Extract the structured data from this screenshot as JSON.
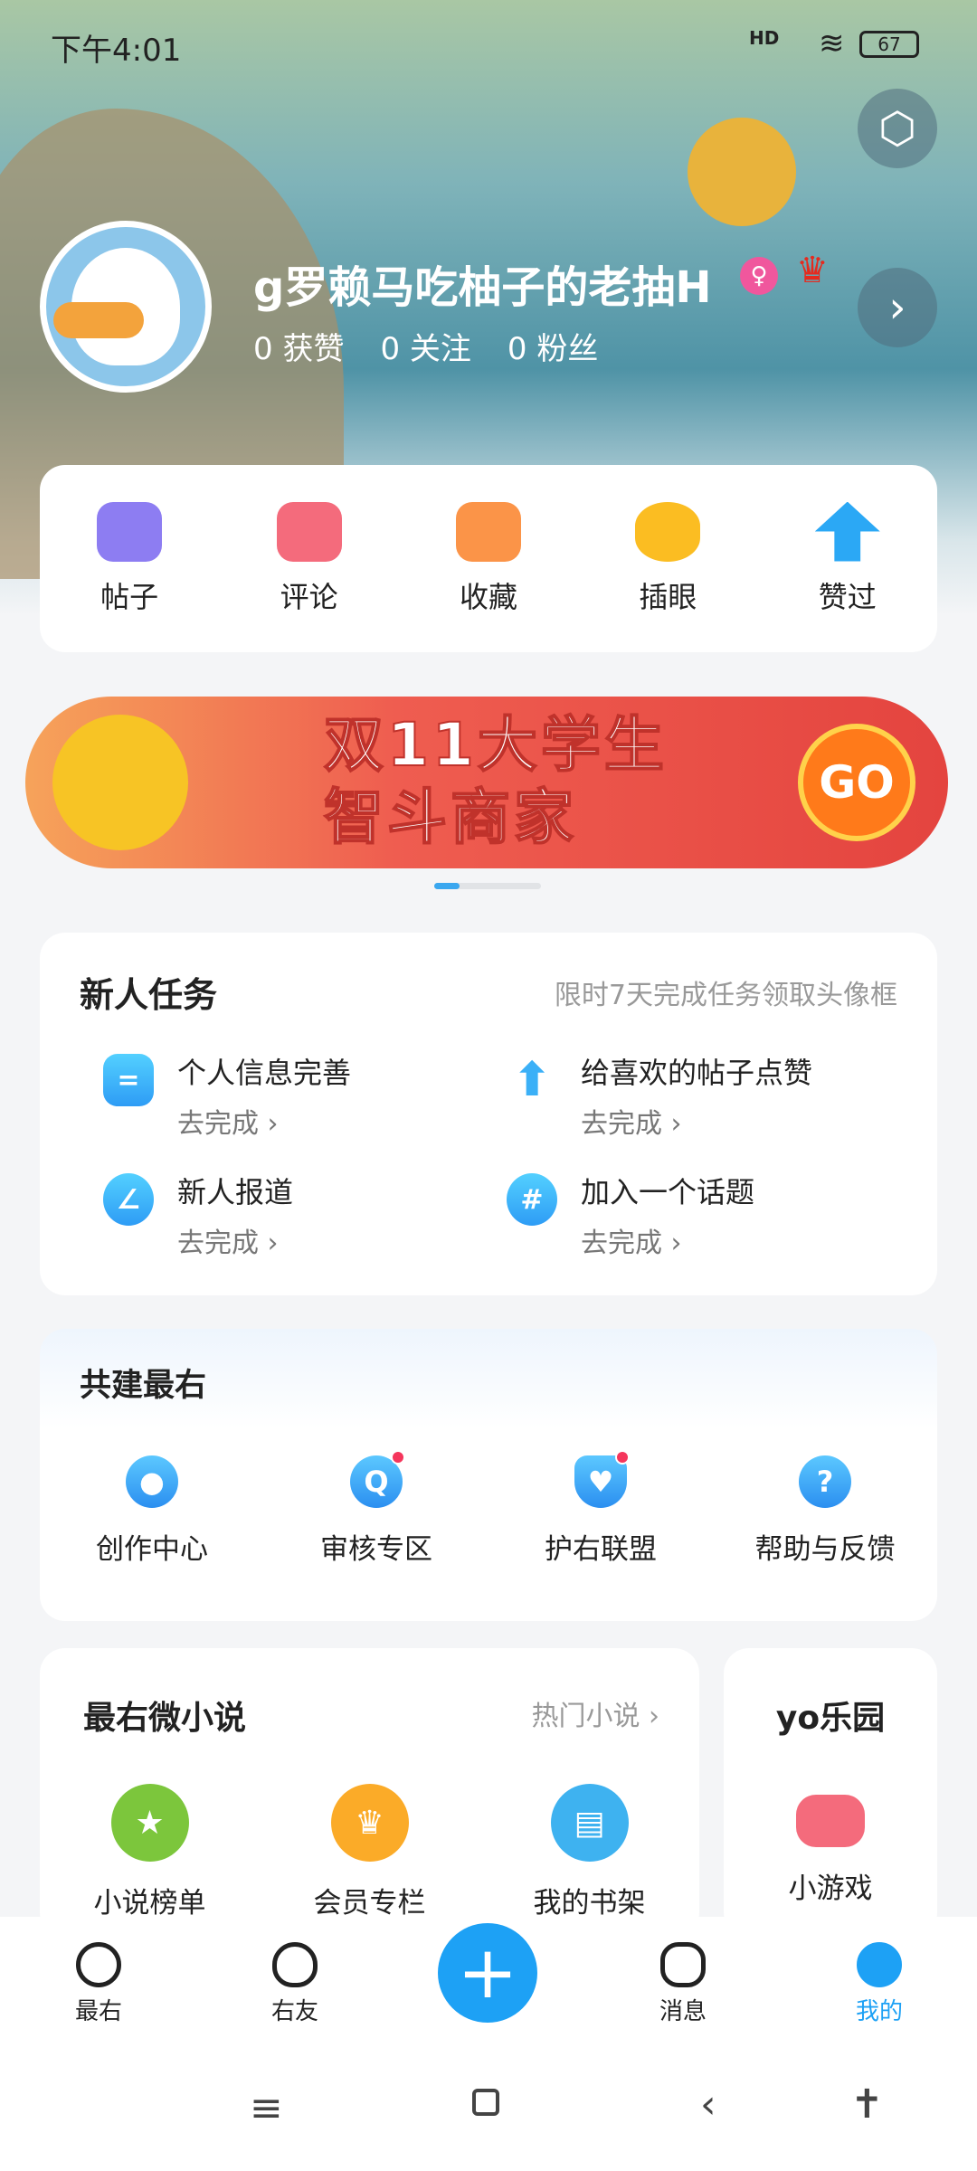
{
  "status_bar": {
    "time": "下午4:01",
    "network": "HD",
    "battery": "67"
  },
  "profile": {
    "username": "g罗赖马吃柚子的老抽H",
    "likes": "0 获赞",
    "following": "0 关注",
    "fans": "0 粉丝"
  },
  "quick_menu": [
    {
      "label": "帖子",
      "color": "#8d7df2"
    },
    {
      "label": "评论",
      "color": "#f46b7c"
    },
    {
      "label": "收藏",
      "color": "#fb9448"
    },
    {
      "label": "插眼",
      "color": "#fbbd22"
    },
    {
      "label": "赞过",
      "color": "#2ba8f5"
    }
  ],
  "banner": {
    "line1": "双11大学生",
    "line2": "智斗商家",
    "go": "GO"
  },
  "tasks": {
    "title": "新人任务",
    "subtitle": "限时7天完成任务领取头像框",
    "items": [
      {
        "name": "个人信息完善",
        "action": "去完成",
        "icon": "="
      },
      {
        "name": "给喜欢的帖子点赞",
        "action": "去完成",
        "icon": "⬆"
      },
      {
        "name": "新人报道",
        "action": "去完成",
        "icon": "∠"
      },
      {
        "name": "加入一个话题",
        "action": "去完成",
        "icon": "#"
      }
    ]
  },
  "coop": {
    "title": "共建最右",
    "items": [
      {
        "label": "创作中心",
        "icon": "💡",
        "badge": false
      },
      {
        "label": "审核专区",
        "icon": "Q",
        "badge": true
      },
      {
        "label": "护右联盟",
        "icon": "♥",
        "badge": true
      },
      {
        "label": "帮助与反馈",
        "icon": "?",
        "badge": false
      }
    ]
  },
  "novel": {
    "title": "最右微小说",
    "link": "热门小说",
    "items": [
      {
        "label": "小说榜单",
        "color": "#7cc63c",
        "icon": "★"
      },
      {
        "label": "会员专栏",
        "color": "#fbab28",
        "icon": "♛"
      },
      {
        "label": "我的书架",
        "color": "#3eb2f0",
        "icon": "▤"
      }
    ]
  },
  "yo": {
    "title": "yo乐园",
    "item": "小游戏"
  },
  "bottom_nav": [
    {
      "label": "最右"
    },
    {
      "label": "右友"
    },
    {
      "label": "消息"
    },
    {
      "label": "我的",
      "active": true
    }
  ],
  "accent": "#1da1f5"
}
